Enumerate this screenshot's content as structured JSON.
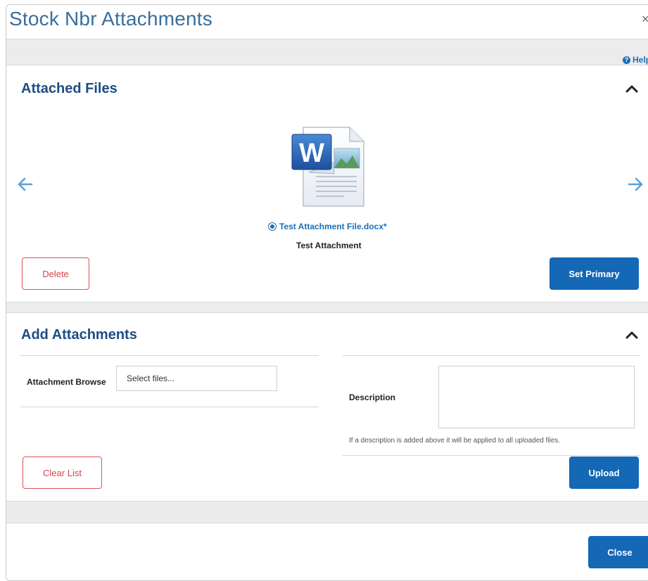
{
  "dialog": {
    "title": "Stock Nbr Attachments",
    "close_glyph": "×",
    "help_label": "Help"
  },
  "attached_files": {
    "section_title": "Attached Files",
    "file": {
      "name": "Test Attachment File.docx*",
      "description": "Test Attachment",
      "icon": "word-document-icon"
    },
    "delete_label": "Delete",
    "set_primary_label": "Set Primary"
  },
  "add_attachments": {
    "section_title": "Add Attachments",
    "browse_label": "Attachment Browse",
    "browse_placeholder": "Select files...",
    "description_label": "Description",
    "description_value": "",
    "hint": "If a description is added above it will be applied to all uploaded files.",
    "clear_list_label": "Clear List",
    "upload_label": "Upload"
  },
  "footer": {
    "close_label": "Close"
  },
  "colors": {
    "title": "#3b6e9c",
    "section_title": "#1e4d84",
    "primary": "#1468b5",
    "danger": "#d9434e",
    "link": "#1a6fb9"
  }
}
